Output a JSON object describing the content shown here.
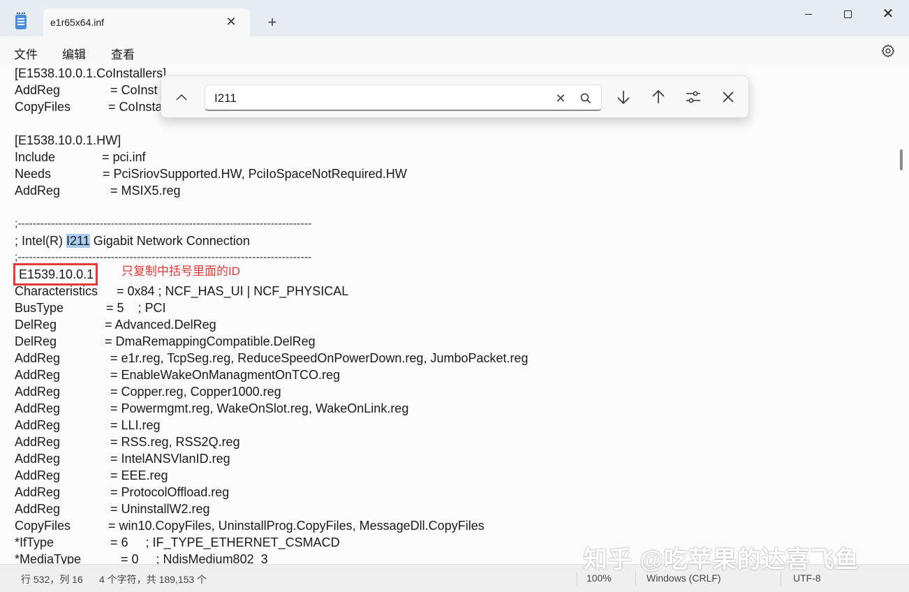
{
  "window": {
    "tab_title": "e1r65x64.inf",
    "new_tab_symbol": "+",
    "tab_close_symbol": "✕",
    "close_symbol": "✕"
  },
  "menu": {
    "file": "文件",
    "edit": "编辑",
    "view": "查看"
  },
  "find": {
    "value": "I211",
    "clear_symbol": "✕"
  },
  "editor": {
    "lines": [
      {
        "key": "[E1538.10.0.1.CoInstallers]",
        "value": ""
      },
      {
        "key": "AddReg",
        "value": "= CoInst"
      },
      {
        "key": "CopyFiles",
        "value": "= CoInsta"
      },
      {
        "key": "",
        "value": ""
      },
      {
        "key": "[E1538.10.0.1.HW]",
        "value": ""
      },
      {
        "key": "Include",
        "value": "= pci.inf"
      },
      {
        "key": "Needs",
        "value": "= PciSriovSupported.HW, PciIoSpaceNotRequired.HW"
      },
      {
        "key": "AddReg",
        "value": "= MSIX5.reg"
      },
      {
        "key": "",
        "value": ""
      },
      {
        "key": ";-------------------------------------------------------------------------------",
        "value": ""
      },
      {
        "key": "; Intel(R) ",
        "highlight": "I211",
        "rest": " Gigabit Network Connection"
      },
      {
        "key": ";-------------------------------------------------------------------------------",
        "value": ""
      },
      {
        "key": "E1539.10.0.1",
        "value": ""
      },
      {
        "key": "Characteristics",
        "value": "= 0x84 ; NCF_HAS_UI | NCF_PHYSICAL"
      },
      {
        "key": "BusType",
        "value": "= 5    ; PCI"
      },
      {
        "key": "DelReg",
        "value": "= Advanced.DelReg"
      },
      {
        "key": "DelReg",
        "value": "= DmaRemappingCompatible.DelReg"
      },
      {
        "key": "AddReg",
        "value": "= e1r.reg, TcpSeg.reg, ReduceSpeedOnPowerDown.reg, JumboPacket.reg"
      },
      {
        "key": "AddReg",
        "value": "= EnableWakeOnManagmentOnTCO.reg"
      },
      {
        "key": "AddReg",
        "value": "= Copper.reg, Copper1000.reg"
      },
      {
        "key": "AddReg",
        "value": "= Powermgmt.reg, WakeOnSlot.reg, WakeOnLink.reg"
      },
      {
        "key": "AddReg",
        "value": "= LLI.reg"
      },
      {
        "key": "AddReg",
        "value": "= RSS.reg, RSS2Q.reg"
      },
      {
        "key": "AddReg",
        "value": "= IntelANSVlanID.reg"
      },
      {
        "key": "AddReg",
        "value": "= EEE.reg"
      },
      {
        "key": "AddReg",
        "value": "= ProtocolOffload.reg"
      },
      {
        "key": "AddReg",
        "value": "= UninstallW2.reg"
      },
      {
        "key": "CopyFiles",
        "value": "= win10.CopyFiles, UninstallProg.CopyFiles, MessageDll.CopyFiles"
      },
      {
        "key": "*IfType",
        "value": "= 6     ; IF_TYPE_ETHERNET_CSMACD"
      },
      {
        "key": "*MediaType",
        "value": "= 0     ; NdisMedium802_3"
      }
    ],
    "annotation": "只复制中括号里面的ID"
  },
  "status": {
    "position": "行 532，列 16",
    "chars": "4 个字符，共 189,153 个",
    "zoom": "100%",
    "eol": "Windows (CRLF)",
    "encoding": "UTF-8"
  },
  "watermark": "知乎 @吃苹果的达喜飞鱼",
  "colors": {
    "highlight": "#a9cdf0",
    "annotation": "#e53935"
  }
}
